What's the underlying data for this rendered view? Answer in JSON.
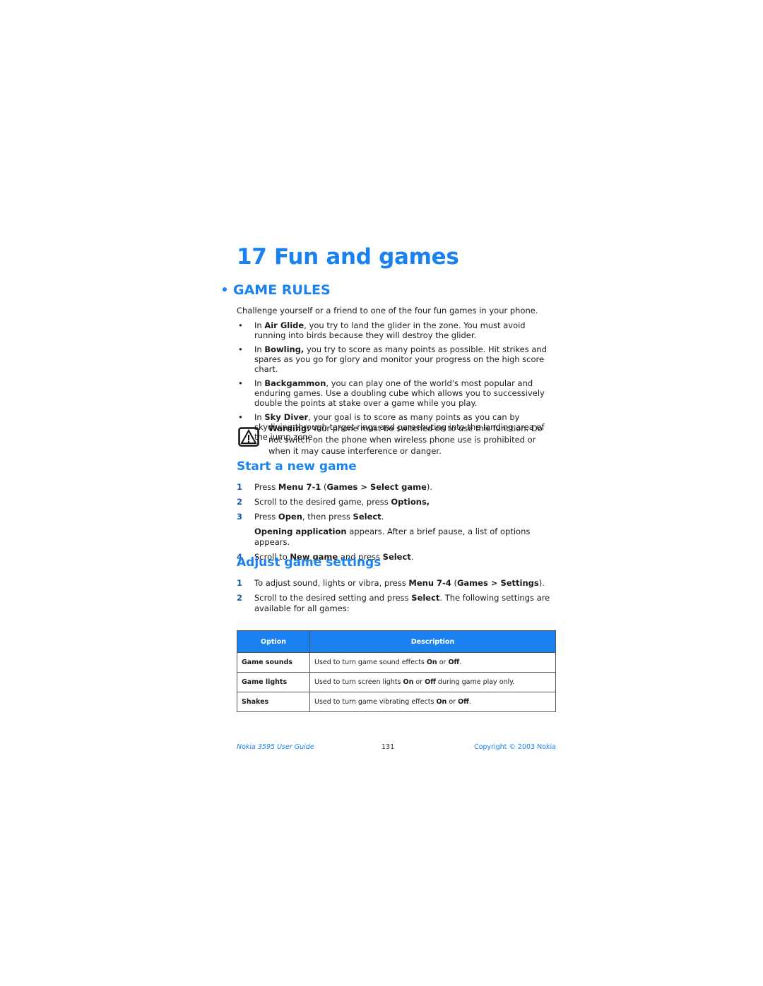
{
  "chapter": {
    "number": "17",
    "title": "17  Fun and games"
  },
  "section": {
    "title": "GAME RULES"
  },
  "intro": "Challenge yourself or a friend to one of the four fun games in your phone.",
  "bullets": [
    {
      "prefix": "In ",
      "bold": "Air Glide",
      "text": ", you try to land the glider in the zone. You must avoid running into birds because they will destroy the glider."
    },
    {
      "prefix": "In ",
      "bold": "Bowling,",
      "text": " you try to score as many points as possible. Hit strikes and spares as you go for glory and monitor your progress on the high score chart."
    },
    {
      "prefix": "In ",
      "bold": "Backgammon",
      "text": ", you can play one of the world's most popular and enduring games. Use a doubling cube which allows you to successively double the points at stake over a game while you play."
    },
    {
      "prefix": "In ",
      "bold": "Sky Diver",
      "text": ", your goal is to score as many points as you can by skydiving through target rings and parachuting into the landing area of the jump zone."
    }
  ],
  "warning": {
    "label": "Warning:",
    "text": " Your phone must be switched on to use this function. Do not switch on the phone when wireless phone use is prohibited or when it may cause interference or danger."
  },
  "start_new_game": {
    "title": "Start a new game",
    "steps": [
      {
        "num": "1",
        "parts": [
          [
            "Press ",
            false
          ],
          [
            "Menu 7-1",
            true
          ],
          [
            " (",
            false
          ],
          [
            "Games > Select game",
            true
          ],
          [
            ").",
            false
          ]
        ]
      },
      {
        "num": "2",
        "parts": [
          [
            "Scroll to the desired game, press ",
            false
          ],
          [
            "Options,",
            true
          ]
        ]
      },
      {
        "num": "3",
        "parts": [
          [
            "Press ",
            false
          ],
          [
            "Open",
            true
          ],
          [
            ", then press ",
            false
          ],
          [
            "Select",
            true
          ],
          [
            ".",
            false
          ]
        ]
      },
      {
        "num": "",
        "parts": [
          [
            "Opening application",
            true
          ],
          [
            " appears. After a brief pause, a list of options appears.",
            false
          ]
        ]
      },
      {
        "num": "4",
        "parts": [
          [
            "Scroll to ",
            false
          ],
          [
            "New game",
            true
          ],
          [
            " and press ",
            false
          ],
          [
            "Select",
            true
          ],
          [
            ".",
            false
          ]
        ]
      }
    ]
  },
  "adjust_settings": {
    "title": "Adjust game settings",
    "steps": [
      {
        "num": "1",
        "parts": [
          [
            "To adjust sound, lights or vibra, press ",
            false
          ],
          [
            "Menu 7-4",
            true
          ],
          [
            " (",
            false
          ],
          [
            "Games > Settings",
            true
          ],
          [
            ").",
            false
          ]
        ]
      },
      {
        "num": "2",
        "parts": [
          [
            "Scroll to the desired setting and press ",
            false
          ],
          [
            "Select",
            true
          ],
          [
            ". The following settings are available for all games:",
            false
          ]
        ]
      }
    ]
  },
  "table": {
    "headers": [
      "Option",
      "Description"
    ],
    "rows": [
      {
        "option": "Game sounds",
        "parts": [
          [
            "Used to turn game sound effects ",
            false
          ],
          [
            "On",
            true
          ],
          [
            " or ",
            false
          ],
          [
            "Off",
            true
          ],
          [
            ".",
            false
          ]
        ]
      },
      {
        "option": "Game lights",
        "parts": [
          [
            "Used to turn screen lights ",
            false
          ],
          [
            "On",
            true
          ],
          [
            " or ",
            false
          ],
          [
            "Off",
            true
          ],
          [
            " during game play only.",
            false
          ]
        ]
      },
      {
        "option": "Shakes",
        "parts": [
          [
            "Used to turn game vibrating effects ",
            false
          ],
          [
            "On",
            true
          ],
          [
            " or ",
            false
          ],
          [
            "Off",
            true
          ],
          [
            ".",
            false
          ]
        ]
      }
    ]
  },
  "footer": {
    "guide": "Nokia 3595 User Guide",
    "page": "131",
    "copyright": "Copyright © 2003 Nokia"
  },
  "colors": {
    "accent": "#1a82f0"
  }
}
